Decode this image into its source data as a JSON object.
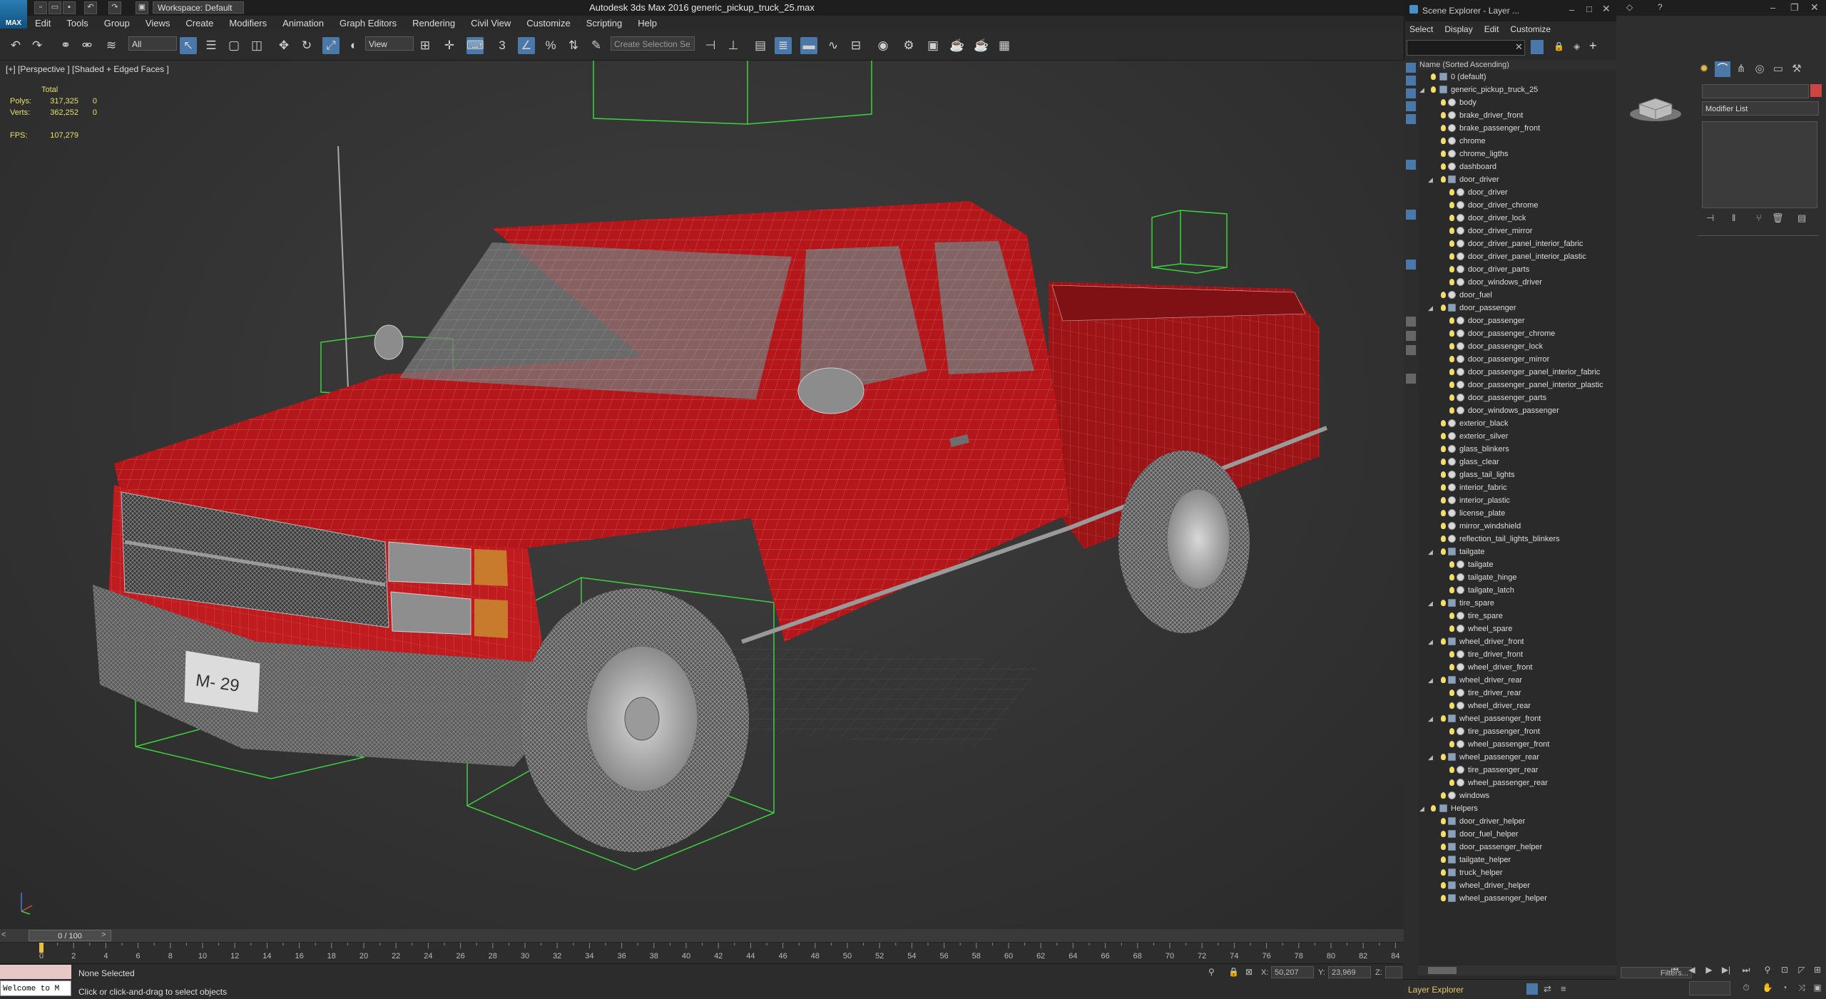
{
  "window": {
    "title": "Autodesk 3ds Max 2016    generic_pickup_truck_25.max",
    "logo_text": "MAX",
    "workspace": "Workspace: Default"
  },
  "menu": [
    "Edit",
    "Tools",
    "Group",
    "Views",
    "Create",
    "Modifiers",
    "Animation",
    "Graph Editors",
    "Rendering",
    "Civil View",
    "Customize",
    "Scripting",
    "Help"
  ],
  "toolbar": {
    "selection_filter": "All",
    "reference_coord": "View",
    "named_selection": "Create Selection Se"
  },
  "viewport": {
    "label": "[+] [Perspective ] [Shaded + Edged Faces ]",
    "stats": {
      "header": "Total",
      "polys_label": "Polys:",
      "polys_value": "317,325",
      "polys_sel": "0",
      "verts_label": "Verts:",
      "verts_value": "362,252",
      "verts_sel": "0",
      "fps_label": "FPS:",
      "fps_value": "107,279"
    },
    "plate_text": "M- 29"
  },
  "timeline": {
    "frame": "0 / 100",
    "ticks": [
      "0",
      "2",
      "4",
      "6",
      "8",
      "10",
      "12",
      "14",
      "16",
      "18",
      "20",
      "22",
      "24",
      "26",
      "28",
      "30",
      "32",
      "34",
      "36",
      "38",
      "40",
      "42",
      "44",
      "46",
      "48",
      "50",
      "52",
      "54",
      "56",
      "58",
      "60",
      "62",
      "64",
      "66",
      "68",
      "70",
      "72",
      "74",
      "76",
      "78",
      "80",
      "82",
      "84"
    ]
  },
  "status": {
    "maxscript_prompt": "Welcome to M",
    "selection": "None Selected",
    "prompt": "Click or click-and-drag to select objects",
    "x_label": "X:",
    "x_value": "50,207",
    "y_label": "Y:",
    "y_value": "23,969",
    "z_label": "Z:"
  },
  "scene_explorer": {
    "title": "Scene Explorer - Layer ...",
    "menu": [
      "Select",
      "Display",
      "Edit",
      "Customize"
    ],
    "header": "Name (Sorted Ascending)",
    "footer": "Layer Explorer",
    "rows": [
      {
        "label": "0 (default)",
        "level": 0,
        "type": "layer",
        "expand": ""
      },
      {
        "label": "generic_pickup_truck_25",
        "level": 0,
        "type": "layer",
        "expand": "open"
      },
      {
        "label": "body",
        "level": 1,
        "type": "obj",
        "expand": ""
      },
      {
        "label": "brake_driver_front",
        "level": 1,
        "type": "obj",
        "expand": ""
      },
      {
        "label": "brake_passenger_front",
        "level": 1,
        "type": "obj",
        "expand": ""
      },
      {
        "label": "chrome",
        "level": 1,
        "type": "obj",
        "expand": ""
      },
      {
        "label": "chrome_ligths",
        "level": 1,
        "type": "obj",
        "expand": ""
      },
      {
        "label": "dashboard",
        "level": 1,
        "type": "obj",
        "expand": ""
      },
      {
        "label": "door_driver",
        "level": 1,
        "type": "layer",
        "expand": "open"
      },
      {
        "label": "door_driver",
        "level": 2,
        "type": "obj",
        "expand": ""
      },
      {
        "label": "door_driver_chrome",
        "level": 2,
        "type": "obj",
        "expand": ""
      },
      {
        "label": "door_driver_lock",
        "level": 2,
        "type": "obj",
        "expand": ""
      },
      {
        "label": "door_driver_mirror",
        "level": 2,
        "type": "obj",
        "expand": ""
      },
      {
        "label": "door_driver_panel_interior_fabric",
        "level": 2,
        "type": "obj",
        "expand": ""
      },
      {
        "label": "door_driver_panel_interior_plastic",
        "level": 2,
        "type": "obj",
        "expand": ""
      },
      {
        "label": "door_driver_parts",
        "level": 2,
        "type": "obj",
        "expand": ""
      },
      {
        "label": "door_windows_driver",
        "level": 2,
        "type": "obj",
        "expand": ""
      },
      {
        "label": "door_fuel",
        "level": 1,
        "type": "obj",
        "expand": ""
      },
      {
        "label": "door_passenger",
        "level": 1,
        "type": "layer",
        "expand": "open"
      },
      {
        "label": "door_passenger",
        "level": 2,
        "type": "obj",
        "expand": ""
      },
      {
        "label": "door_passenger_chrome",
        "level": 2,
        "type": "obj",
        "expand": ""
      },
      {
        "label": "door_passenger_lock",
        "level": 2,
        "type": "obj",
        "expand": ""
      },
      {
        "label": "door_passenger_mirror",
        "level": 2,
        "type": "obj",
        "expand": ""
      },
      {
        "label": "door_passenger_panel_interior_fabric",
        "level": 2,
        "type": "obj",
        "expand": ""
      },
      {
        "label": "door_passenger_panel_interior_plastic",
        "level": 2,
        "type": "obj",
        "expand": ""
      },
      {
        "label": "door_passenger_parts",
        "level": 2,
        "type": "obj",
        "expand": ""
      },
      {
        "label": "door_windows_passenger",
        "level": 2,
        "type": "obj",
        "expand": ""
      },
      {
        "label": "exterior_black",
        "level": 1,
        "type": "obj",
        "expand": ""
      },
      {
        "label": "exterior_silver",
        "level": 1,
        "type": "obj",
        "expand": ""
      },
      {
        "label": "glass_blinkers",
        "level": 1,
        "type": "obj",
        "expand": ""
      },
      {
        "label": "glass_clear",
        "level": 1,
        "type": "obj",
        "expand": ""
      },
      {
        "label": "glass_tail_lights",
        "level": 1,
        "type": "obj",
        "expand": ""
      },
      {
        "label": "interior_fabric",
        "level": 1,
        "type": "obj",
        "expand": ""
      },
      {
        "label": "interior_plastic",
        "level": 1,
        "type": "obj",
        "expand": ""
      },
      {
        "label": "license_plate",
        "level": 1,
        "type": "obj",
        "expand": ""
      },
      {
        "label": "mirror_windshield",
        "level": 1,
        "type": "obj",
        "expand": ""
      },
      {
        "label": "reflection_tail_lights_blinkers",
        "level": 1,
        "type": "obj",
        "expand": ""
      },
      {
        "label": "tailgate",
        "level": 1,
        "type": "layer",
        "expand": "open"
      },
      {
        "label": "tailgate",
        "level": 2,
        "type": "obj",
        "expand": ""
      },
      {
        "label": "tailgate_hinge",
        "level": 2,
        "type": "obj",
        "expand": ""
      },
      {
        "label": "tailgate_latch",
        "level": 2,
        "type": "obj",
        "expand": ""
      },
      {
        "label": "tire_spare",
        "level": 1,
        "type": "layer",
        "expand": "open"
      },
      {
        "label": "tire_spare",
        "level": 2,
        "type": "obj",
        "expand": ""
      },
      {
        "label": "wheel_spare",
        "level": 2,
        "type": "obj",
        "expand": ""
      },
      {
        "label": "wheel_driver_front",
        "level": 1,
        "type": "layer",
        "expand": "open"
      },
      {
        "label": "tire_driver_front",
        "level": 2,
        "type": "obj",
        "expand": ""
      },
      {
        "label": "wheel_driver_front",
        "level": 2,
        "type": "obj",
        "expand": ""
      },
      {
        "label": "wheel_driver_rear",
        "level": 1,
        "type": "layer",
        "expand": "open"
      },
      {
        "label": "tire_driver_rear",
        "level": 2,
        "type": "obj",
        "expand": ""
      },
      {
        "label": "wheel_driver_rear",
        "level": 2,
        "type": "obj",
        "expand": ""
      },
      {
        "label": "wheel_passenger_front",
        "level": 1,
        "type": "layer",
        "expand": "open"
      },
      {
        "label": "tire_passenger_front",
        "level": 2,
        "type": "obj",
        "expand": ""
      },
      {
        "label": "wheel_passenger_front",
        "level": 2,
        "type": "obj",
        "expand": ""
      },
      {
        "label": "wheel_passenger_rear",
        "level": 1,
        "type": "layer",
        "expand": "open"
      },
      {
        "label": "tire_passenger_rear",
        "level": 2,
        "type": "obj",
        "expand": ""
      },
      {
        "label": "wheel_passenger_rear",
        "level": 2,
        "type": "obj",
        "expand": ""
      },
      {
        "label": "windows",
        "level": 1,
        "type": "obj",
        "expand": ""
      },
      {
        "label": "Helpers",
        "level": 0,
        "type": "layer",
        "expand": "open"
      },
      {
        "label": "door_driver_helper",
        "level": 1,
        "type": "layer",
        "expand": ""
      },
      {
        "label": "door_fuel_helper",
        "level": 1,
        "type": "layer",
        "expand": ""
      },
      {
        "label": "door_passenger_helper",
        "level": 1,
        "type": "layer",
        "expand": ""
      },
      {
        "label": "tailgate_helper",
        "level": 1,
        "type": "layer",
        "expand": ""
      },
      {
        "label": "truck_helper",
        "level": 1,
        "type": "layer",
        "expand": ""
      },
      {
        "label": "wheel_driver_helper",
        "level": 1,
        "type": "layer",
        "expand": ""
      },
      {
        "label": "wheel_passenger_helper",
        "level": 1,
        "type": "layer",
        "expand": ""
      }
    ]
  },
  "command_panel": {
    "modifier_list": "Modifier List",
    "filters": "Filters..."
  },
  "colors": {
    "truck_red": "#b4161a",
    "helper_green": "#3cd23c",
    "bulb_yellow": "#f2dd6a",
    "accent_blue": "#4a78a8"
  }
}
